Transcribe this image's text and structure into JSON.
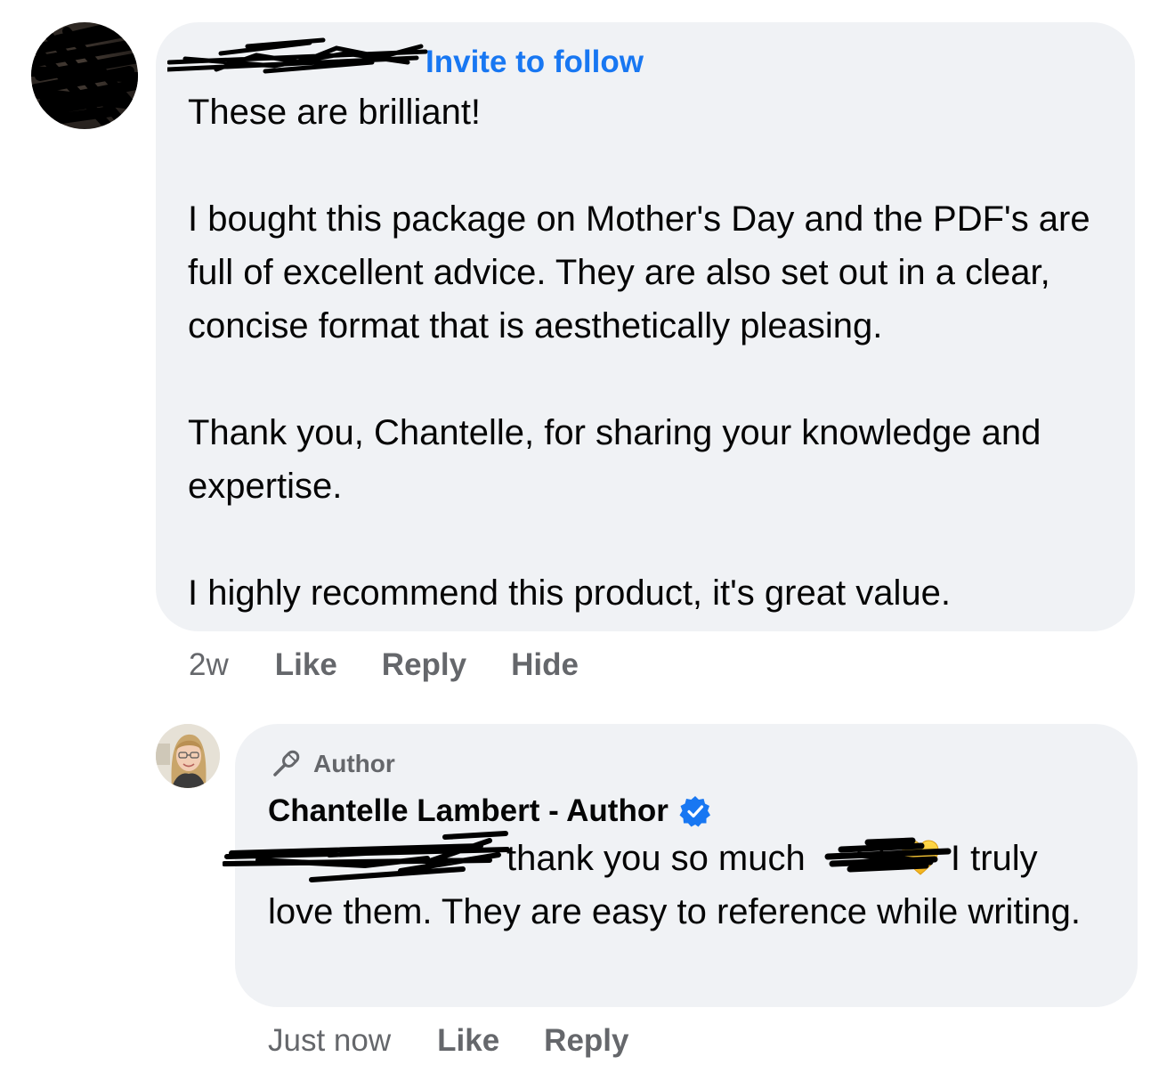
{
  "comment": {
    "invite_link": "Invite to follow",
    "paragraphs": [
      "These are brilliant!",
      "I bought this package on Mother's Day and the PDF's are full of excellent advice. They are also set out in a clear, concise format that is aesthetically pleasing.",
      "Thank you, Chantelle, for sharing your knowledge and expertise.",
      "I highly recommend this product, it's great value."
    ],
    "time": "2w",
    "actions": {
      "like": "Like",
      "reply": "Reply",
      "hide": "Hide"
    }
  },
  "reply": {
    "badge": "Author",
    "badge_icon": "microphone-icon",
    "author_name": "Chantelle Lambert - Author",
    "verified_icon": "verified-badge-icon",
    "text_part1": "thank you so much",
    "text_part1_suffix": "!",
    "emoji": "yellow-heart",
    "text_part2": "I truly",
    "text_rest": "love them. They are easy to reference while writing.",
    "time": "Just now",
    "actions": {
      "like": "Like",
      "reply": "Reply"
    }
  },
  "colors": {
    "bubble": "#f0f2f5",
    "link": "#1877f2",
    "meta": "#65676b",
    "text": "#050505"
  }
}
